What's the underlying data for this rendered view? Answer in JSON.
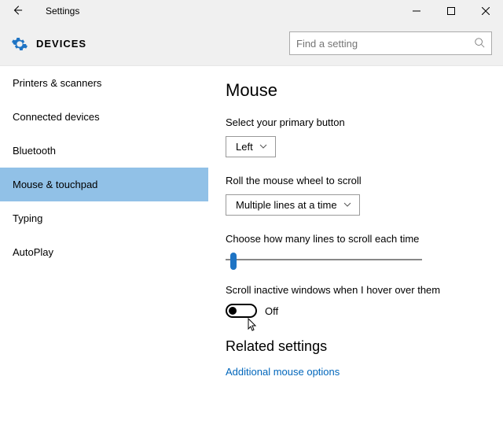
{
  "window": {
    "title": "Settings"
  },
  "header": {
    "heading": "DEVICES",
    "search_placeholder": "Find a setting"
  },
  "sidebar": {
    "items": [
      {
        "label": "Printers & scanners",
        "active": false
      },
      {
        "label": "Connected devices",
        "active": false
      },
      {
        "label": "Bluetooth",
        "active": false
      },
      {
        "label": "Mouse & touchpad",
        "active": true
      },
      {
        "label": "Typing",
        "active": false
      },
      {
        "label": "AutoPlay",
        "active": false
      }
    ]
  },
  "main": {
    "title": "Mouse",
    "primary_label": "Select your primary button",
    "primary_value": "Left",
    "wheel_label": "Roll the mouse wheel to scroll",
    "wheel_value": "Multiple lines at a time",
    "lines_label": "Choose how many lines to scroll each time",
    "hover_label": "Scroll inactive windows when I hover over them",
    "hover_state": "Off",
    "related_heading": "Related settings",
    "related_link": "Additional mouse options"
  }
}
